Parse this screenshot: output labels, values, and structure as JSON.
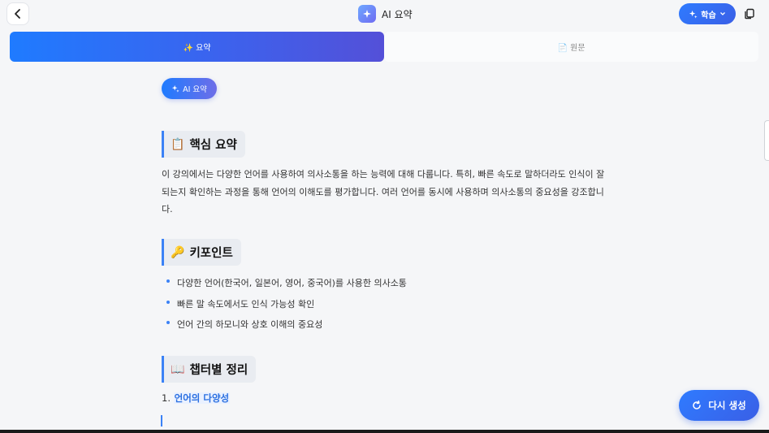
{
  "header": {
    "title": "AI 요약",
    "learn_label": "학습"
  },
  "tabs": [
    {
      "label": "✨ 요약",
      "active": true
    },
    {
      "label": "📄 원문",
      "active": false
    }
  ],
  "badge": {
    "label": "AI 요약"
  },
  "sections": {
    "summary": {
      "emoji": "📋",
      "title": "핵심 요약",
      "text": "이 강의에서는 다양한 언어를 사용하여 의사소통을 하는 능력에 대해 다룹니다. 특히, 빠른 속도로 말하더라도 인식이 잘 되는지 확인하는 과정을 통해 언어의 이해도를 평가합니다. 여러 언어를 동시에 사용하며 의사소통의 중요성을 강조합니다."
    },
    "keypoints": {
      "emoji": "🔑",
      "title": "키포인트",
      "items": [
        "다양한 언어(한국어, 일본어, 영어, 중국어)를 사용한 의사소통",
        "빠른 말 속도에서도 인식 가능성 확인",
        "언어 간의 하모니와 상호 이해의 중요성"
      ]
    },
    "chapters": {
      "emoji": "📖",
      "title": "챕터별 정리",
      "items": [
        {
          "number": "1.",
          "title": "언어의 다양성"
        }
      ]
    }
  },
  "regenerate_label": "다시 생성",
  "colors": {
    "accent": "#2f7bff",
    "accent_purple": "#5450d8",
    "background": "#f5f6f8",
    "link": "#2a6fe0"
  }
}
